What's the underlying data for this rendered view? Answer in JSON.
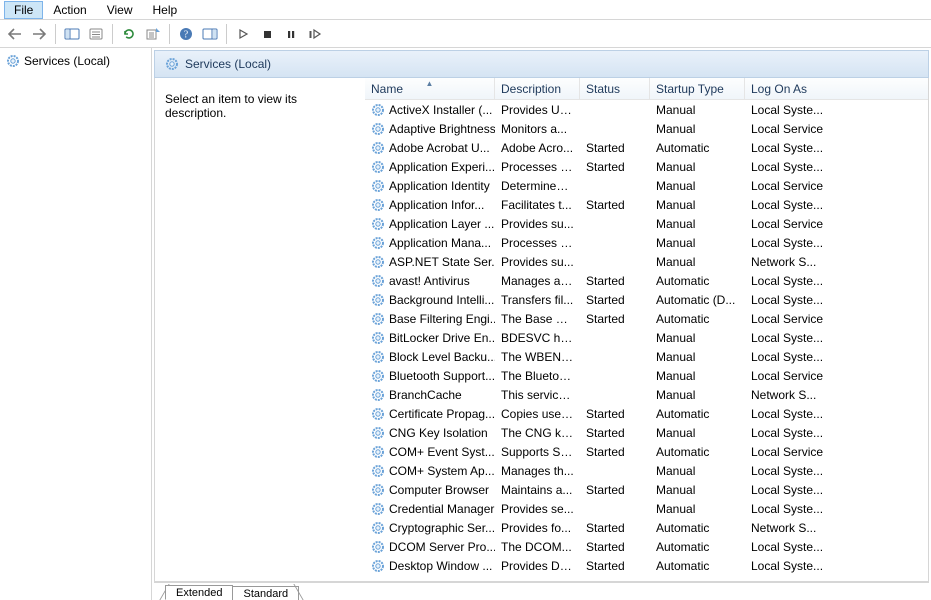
{
  "menu": {
    "file": "File",
    "action": "Action",
    "view": "View",
    "help": "Help"
  },
  "tree": {
    "root": "Services (Local)"
  },
  "main": {
    "header": "Services (Local)",
    "desc_hint": "Select an item to view its description."
  },
  "columns": {
    "name": "Name",
    "desc": "Description",
    "status": "Status",
    "startup": "Startup Type",
    "logon": "Log On As"
  },
  "tabs": {
    "extended": "Extended",
    "standard": "Standard"
  },
  "services": [
    {
      "name": "ActiveX Installer (...",
      "desc": "Provides Us...",
      "status": "",
      "startup": "Manual",
      "logon": "Local Syste..."
    },
    {
      "name": "Adaptive Brightness",
      "desc": "Monitors a...",
      "status": "",
      "startup": "Manual",
      "logon": "Local Service"
    },
    {
      "name": "Adobe Acrobat U...",
      "desc": "Adobe Acro...",
      "status": "Started",
      "startup": "Automatic",
      "logon": "Local Syste..."
    },
    {
      "name": "Application Experi...",
      "desc": "Processes a...",
      "status": "Started",
      "startup": "Manual",
      "logon": "Local Syste..."
    },
    {
      "name": "Application Identity",
      "desc": "Determines ...",
      "status": "",
      "startup": "Manual",
      "logon": "Local Service"
    },
    {
      "name": "Application Infor...",
      "desc": "Facilitates t...",
      "status": "Started",
      "startup": "Manual",
      "logon": "Local Syste..."
    },
    {
      "name": "Application Layer ...",
      "desc": "Provides su...",
      "status": "",
      "startup": "Manual",
      "logon": "Local Service"
    },
    {
      "name": "Application Mana...",
      "desc": "Processes in...",
      "status": "",
      "startup": "Manual",
      "logon": "Local Syste..."
    },
    {
      "name": "ASP.NET State Ser...",
      "desc": "Provides su...",
      "status": "",
      "startup": "Manual",
      "logon": "Network S..."
    },
    {
      "name": "avast! Antivirus",
      "desc": "Manages an...",
      "status": "Started",
      "startup": "Automatic",
      "logon": "Local Syste..."
    },
    {
      "name": "Background Intelli...",
      "desc": "Transfers fil...",
      "status": "Started",
      "startup": "Automatic (D...",
      "logon": "Local Syste..."
    },
    {
      "name": "Base Filtering Engi...",
      "desc": "The Base Fil...",
      "status": "Started",
      "startup": "Automatic",
      "logon": "Local Service"
    },
    {
      "name": "BitLocker Drive En...",
      "desc": "BDESVC hos...",
      "status": "",
      "startup": "Manual",
      "logon": "Local Syste..."
    },
    {
      "name": "Block Level Backu...",
      "desc": "The WBENG...",
      "status": "",
      "startup": "Manual",
      "logon": "Local Syste..."
    },
    {
      "name": "Bluetooth Support...",
      "desc": "The Bluetoo...",
      "status": "",
      "startup": "Manual",
      "logon": "Local Service"
    },
    {
      "name": "BranchCache",
      "desc": "This service ...",
      "status": "",
      "startup": "Manual",
      "logon": "Network S..."
    },
    {
      "name": "Certificate Propag...",
      "desc": "Copies user ...",
      "status": "Started",
      "startup": "Automatic",
      "logon": "Local Syste..."
    },
    {
      "name": "CNG Key Isolation",
      "desc": "The CNG ke...",
      "status": "Started",
      "startup": "Manual",
      "logon": "Local Syste..."
    },
    {
      "name": "COM+ Event Syst...",
      "desc": "Supports Sy...",
      "status": "Started",
      "startup": "Automatic",
      "logon": "Local Service"
    },
    {
      "name": "COM+ System Ap...",
      "desc": "Manages th...",
      "status": "",
      "startup": "Manual",
      "logon": "Local Syste..."
    },
    {
      "name": "Computer Browser",
      "desc": "Maintains a...",
      "status": "Started",
      "startup": "Manual",
      "logon": "Local Syste..."
    },
    {
      "name": "Credential Manager",
      "desc": "Provides se...",
      "status": "",
      "startup": "Manual",
      "logon": "Local Syste..."
    },
    {
      "name": "Cryptographic Ser...",
      "desc": "Provides fo...",
      "status": "Started",
      "startup": "Automatic",
      "logon": "Network S..."
    },
    {
      "name": "DCOM Server Pro...",
      "desc": "The DCOM...",
      "status": "Started",
      "startup": "Automatic",
      "logon": "Local Syste..."
    },
    {
      "name": "Desktop Window ...",
      "desc": "Provides De...",
      "status": "Started",
      "startup": "Automatic",
      "logon": "Local Syste..."
    }
  ]
}
